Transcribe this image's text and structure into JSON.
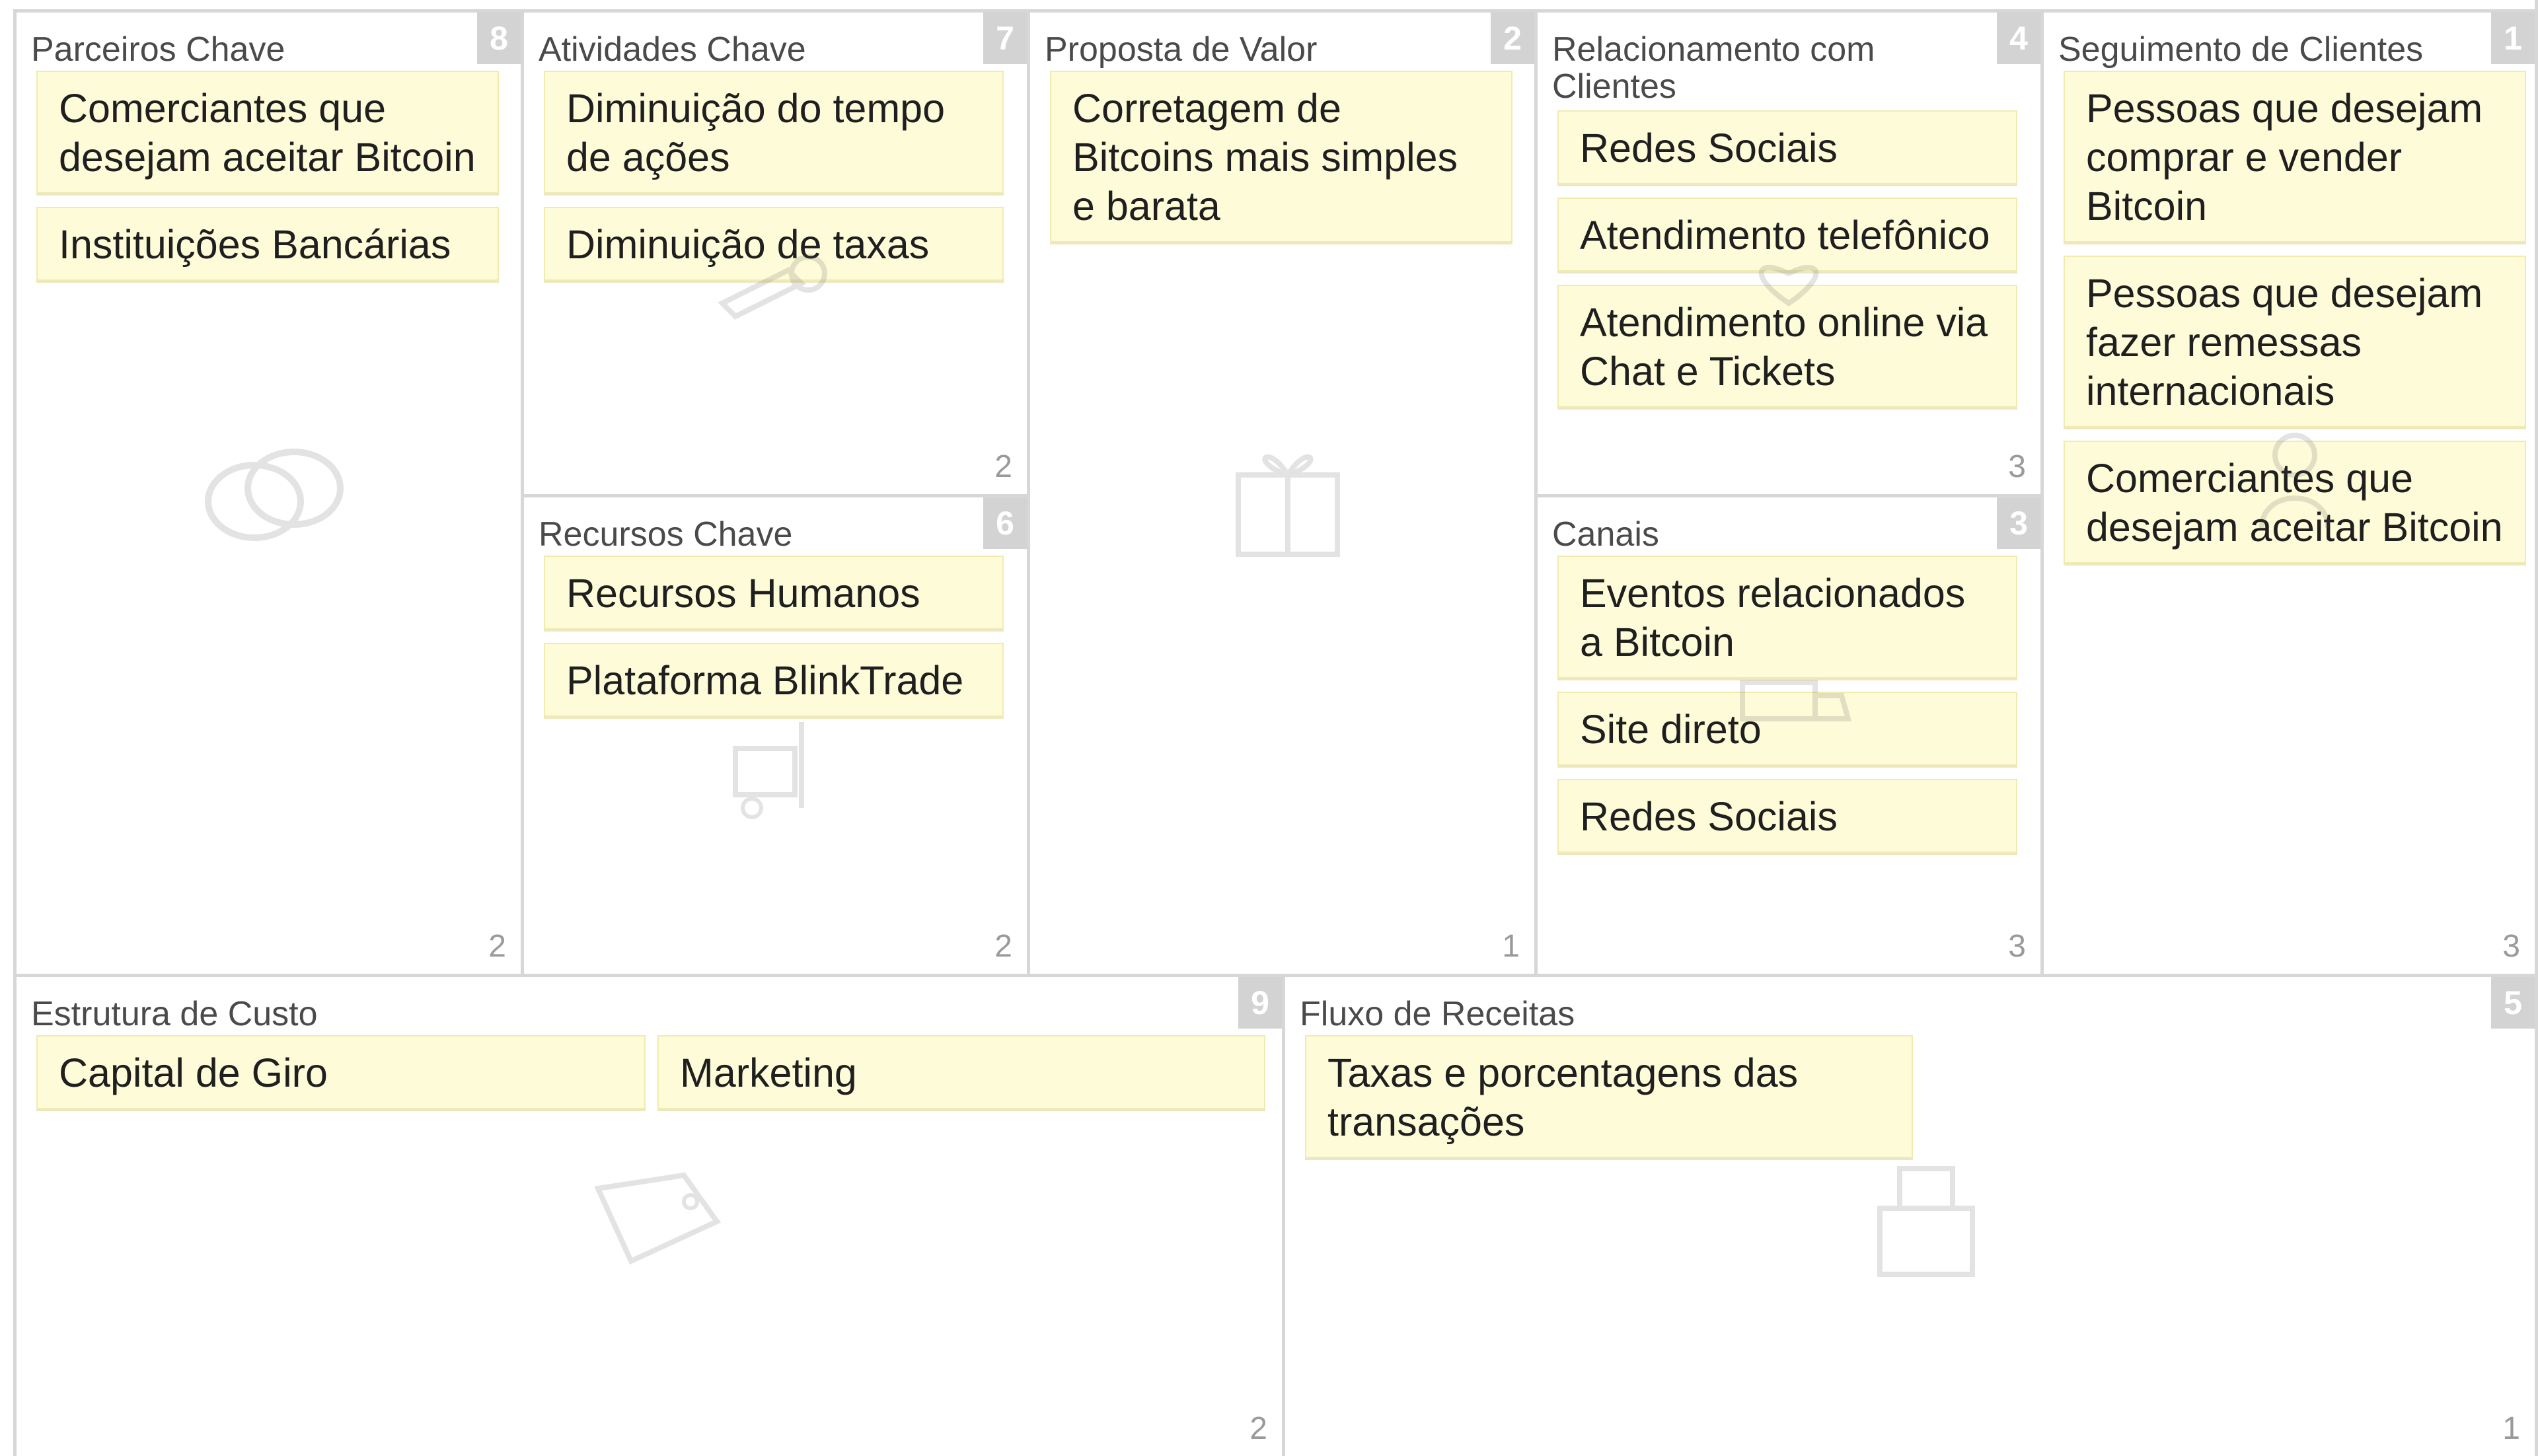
{
  "canvas": {
    "blocks": {
      "key_partners": {
        "title": "Parceiros Chave",
        "badge": "8",
        "count": "2",
        "icon": "rings-icon",
        "notes": [
          "Comerciantes que desejam aceitar Bitcoin",
          "Instituições Bancárias"
        ]
      },
      "key_activities": {
        "title": "Atividades Chave",
        "badge": "7",
        "count": "2",
        "icon": "tools-icon",
        "notes": [
          "Diminuição do tempo de ações",
          "Diminuição de taxas"
        ]
      },
      "key_resources": {
        "title": "Recursos Chave",
        "badge": "6",
        "count": "2",
        "icon": "forklift-icon",
        "notes": [
          "Recursos Humanos",
          "Plataforma BlinkTrade"
        ]
      },
      "value_proposition": {
        "title": "Proposta de Valor",
        "badge": "2",
        "count": "1",
        "icon": "gift-icon",
        "notes": [
          "Corretagem de Bitcoins mais simples e barata"
        ]
      },
      "customer_relationships": {
        "title": "Relacionamento com Clientes",
        "badge": "4",
        "count": "3",
        "icon": "heart-icon",
        "notes": [
          "Redes Sociais",
          "Atendimento telefônico",
          "Atendimento online via Chat e Tickets"
        ]
      },
      "channels": {
        "title": "Canais",
        "badge": "3",
        "count": "3",
        "icon": "truck-icon",
        "notes": [
          "Eventos relacionados a Bitcoin",
          "Site direto",
          "Redes Sociais"
        ]
      },
      "customer_segments": {
        "title": "Seguimento de Clientes",
        "badge": "1",
        "count": "3",
        "icon": "people-icon",
        "notes": [
          "Pessoas que desejam comprar e vender Bitcoin",
          "Pessoas que desejam fazer remessas internacionais",
          "Comerciantes que desejam aceitar Bitcoin"
        ]
      },
      "cost_structure": {
        "title": "Estrutura de Custo",
        "badge": "9",
        "count": "2",
        "icon": "price-tag-icon",
        "notes": [
          "Capital de Giro",
          "Marketing"
        ]
      },
      "revenue_streams": {
        "title": "Fluxo de Receitas",
        "badge": "5",
        "count": "1",
        "icon": "cash-register-icon",
        "notes": [
          "Taxas e porcentagens das transações"
        ]
      }
    }
  },
  "colors": {
    "note_bg": "#fdfbd8",
    "border": "#d7d7d7",
    "badge_bg": "#d3d3d3"
  }
}
